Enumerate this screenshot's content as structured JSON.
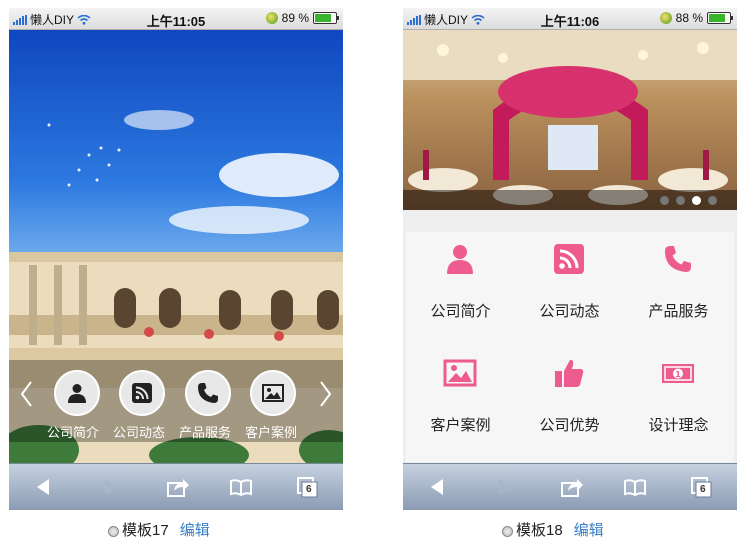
{
  "status": {
    "carrier": "懒人DIY",
    "phone1_time": "上午11:05",
    "phone1_battery": "89 %",
    "phone1_battery_level": 0.89,
    "phone2_time": "上午11:06",
    "phone2_battery": "88 %",
    "phone2_battery_level": 0.88
  },
  "template17": {
    "menu": [
      "公司简介",
      "公司动态",
      "产品服务",
      "客户案例"
    ],
    "icons": [
      "user-icon",
      "rss-icon",
      "phone-icon",
      "image-icon"
    ],
    "caption": "模板17",
    "edit": "编辑"
  },
  "template18": {
    "menu": [
      "公司简介",
      "公司动态",
      "产品服务",
      "客户案例",
      "公司优势",
      "设计理念"
    ],
    "icons": [
      "user-icon",
      "rss-icon",
      "phone-icon",
      "image-icon",
      "thumbs-up-icon",
      "banknote-icon"
    ],
    "accent": "#ee5b8e",
    "slides_total": 4,
    "active_slide": 3,
    "caption": "模板18",
    "edit": "编辑"
  },
  "toolbar": {
    "tab_count": "6",
    "icons": [
      "back-arrow-icon",
      "forward-arrow-icon",
      "share-icon",
      "bookmarks-icon",
      "tabs-icon"
    ]
  }
}
